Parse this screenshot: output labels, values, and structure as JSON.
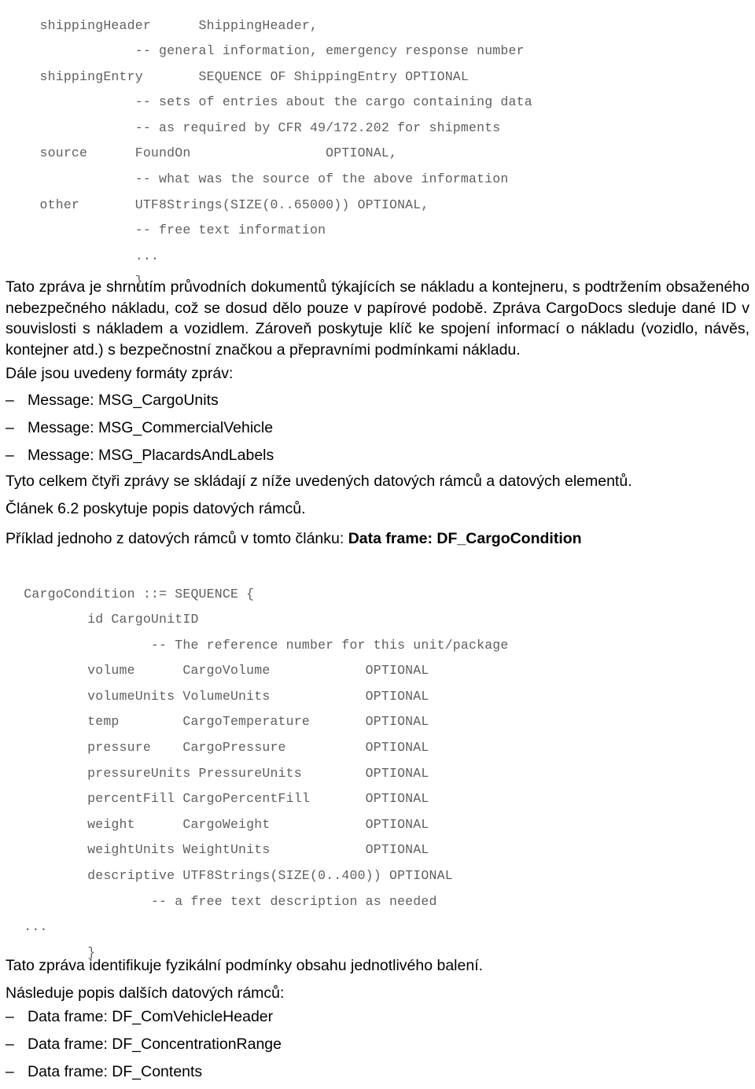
{
  "document": {
    "language": "cs",
    "code_block_top": {
      "lines": [
        "     shippingHeader      ShippingHeader,",
        "                 -- general information, emergency response number",
        "     shippingEntry       SEQUENCE OF ShippingEntry OPTIONAL",
        "                 -- sets of entries about the cargo containing data",
        "                 -- as required by CFR 49/172.202 for shipments",
        "     source      FoundOn                 OPTIONAL,",
        "                 -- what was the source of the above information",
        "     other       UTF8Strings(SIZE(0..65000)) OPTIONAL,",
        "                 -- free text information",
        "                 ...",
        "                 }"
      ]
    },
    "paragraph_intro": "Tato zpráva je shrnutím průvodních dokumentů týkajících se nákladu a kontejneru, s podtržením obsaženého nebezpečného nákladu, což se dosud dělo pouze v papírové podobě. Zpráva CargoDocs sleduje dané ID v souvislosti s nákladem a vozidlem. Zároveň poskytuje klíč ke spojení informací o nákladu (vozidlo, návěs, kontejner atd.) s bezpečnostní značkou a přepravními podmínkami nákladu.",
    "line_formats": "Dále jsou uvedeny formáty zpráv:",
    "bullet_marker": "–",
    "message_list": [
      "Message: MSG_CargoUnits",
      "Message: MSG_CommercialVehicle",
      "Message: MSG_PlacardsAndLabels"
    ],
    "line_four_messages": "Tyto celkem čtyři zprávy se skládají z níže uvedených datových rámců a datových elementů.",
    "line_article": "Článek 6.2 poskytuje popis datových rámců.",
    "line_example_prefix": "Příklad jednoho z datových rámců v tomto článku: ",
    "line_example_bold": "Data frame: DF_CargoCondition",
    "code_block_bottom": {
      "lines": [
        "   CargoCondition ::= SEQUENCE {",
        "           id CargoUnitID",
        "                   -- The reference number for this unit/package",
        "           volume      CargoVolume            OPTIONAL",
        "           volumeUnits VolumeUnits            OPTIONAL",
        "           temp        CargoTemperature       OPTIONAL",
        "           pressure    CargoPressure          OPTIONAL",
        "           pressureUnits PressureUnits        OPTIONAL",
        "           percentFill CargoPercentFill       OPTIONAL",
        "           weight      CargoWeight            OPTIONAL",
        "           weightUnits WeightUnits            OPTIONAL",
        "           descriptive UTF8Strings(SIZE(0..400)) OPTIONAL",
        "                   -- a free text description as needed",
        "   ...",
        "           }"
      ]
    },
    "line_identifies": "Tato zpráva identifikuje fyzikální podmínky obsahu jednotlivého balení.",
    "line_follows": "Následuje popis dalších datových rámců:",
    "dataframe_list": [
      "Data frame: DF_ComVehicleHeader",
      "Data frame: DF_ConcentrationRange",
      "Data frame: DF_Contents"
    ],
    "colors": {
      "code_text": "#5f5f5f",
      "body_text": "#000000",
      "page_background": "#ffffff"
    }
  }
}
